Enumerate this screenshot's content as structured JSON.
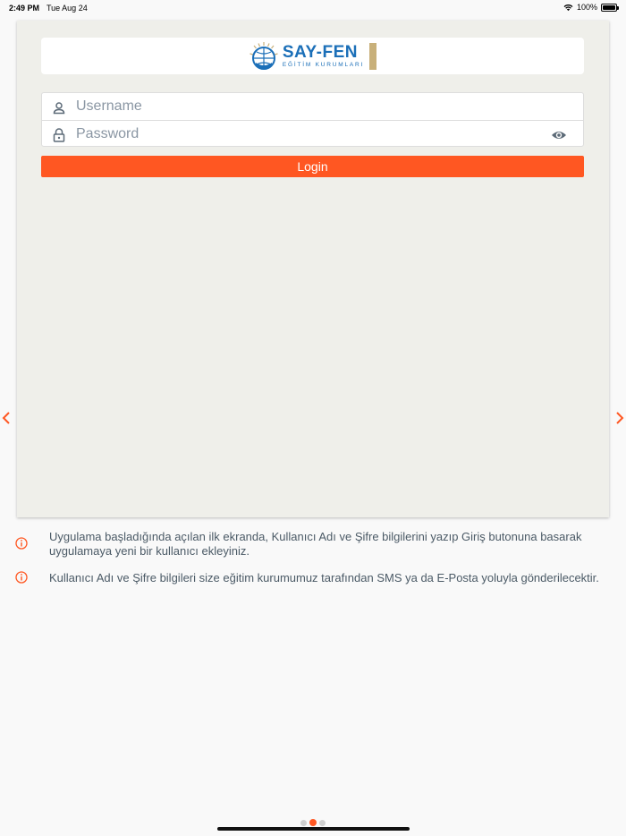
{
  "status_bar": {
    "time": "2:49 PM",
    "date": "Tue Aug 24",
    "battery": "100%"
  },
  "logo": {
    "main": "SAY-FEN",
    "sub": "EĞİTİM KURUMLARI"
  },
  "login_form": {
    "username_placeholder": "Username",
    "password_placeholder": "Password",
    "login_label": "Login"
  },
  "info": [
    "Uygulama başladığında açılan ilk ekranda, Kullanıcı Adı ve Şifre bilgilerini yazıp Giriş butonuna basarak uygulamaya yeni bir kullanıcı ekleyiniz.",
    "Kullanıcı Adı ve Şifre bilgileri size eğitim kurumumuz tarafından SMS ya da E-Posta yoluyla gönderilecektir."
  ],
  "pager": {
    "total": 3,
    "active_index": 1
  },
  "colors": {
    "accent": "#ff5722",
    "brand_blue": "#1b6fb8",
    "card_bg": "#efefea",
    "info_text": "#4b5a66"
  },
  "icons": [
    "wifi-icon",
    "battery-icon",
    "user-icon",
    "lock-icon",
    "eye-icon",
    "chevron-left-icon",
    "chevron-right-icon",
    "info-icon"
  ]
}
